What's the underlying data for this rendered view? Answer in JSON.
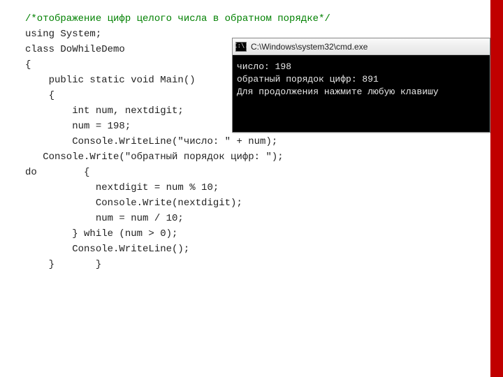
{
  "code": {
    "comment": "/*отображение цифр целого числа в обратном порядке*/",
    "l1": "using System;",
    "l2": "class DoWhileDemo",
    "l3": "{",
    "l4": "    public static void Main()",
    "l5": "    {",
    "l6": "        int num, nextdigit;",
    "l7": "        num = 198;",
    "l8": "        Console.WriteLine(\"число: \" + num);",
    "l9": "   Console.Write(\"обратный порядок цифр: \");",
    "l10": "do        {",
    "l11": "            nextdigit = num % 10;",
    "l12": "            Console.Write(nextdigit);",
    "l13": "            num = num / 10;",
    "l14": "        } while (num > 0);",
    "l15": "        Console.WriteLine();",
    "l16": "    }       }"
  },
  "cmd": {
    "icon_text": "C:\\.",
    "title": "C:\\Windows\\system32\\cmd.exe",
    "line1": "число: 198",
    "line2": "обратный порядок цифр: 891",
    "line3": "Для продолжения нажмите любую клавишу"
  }
}
